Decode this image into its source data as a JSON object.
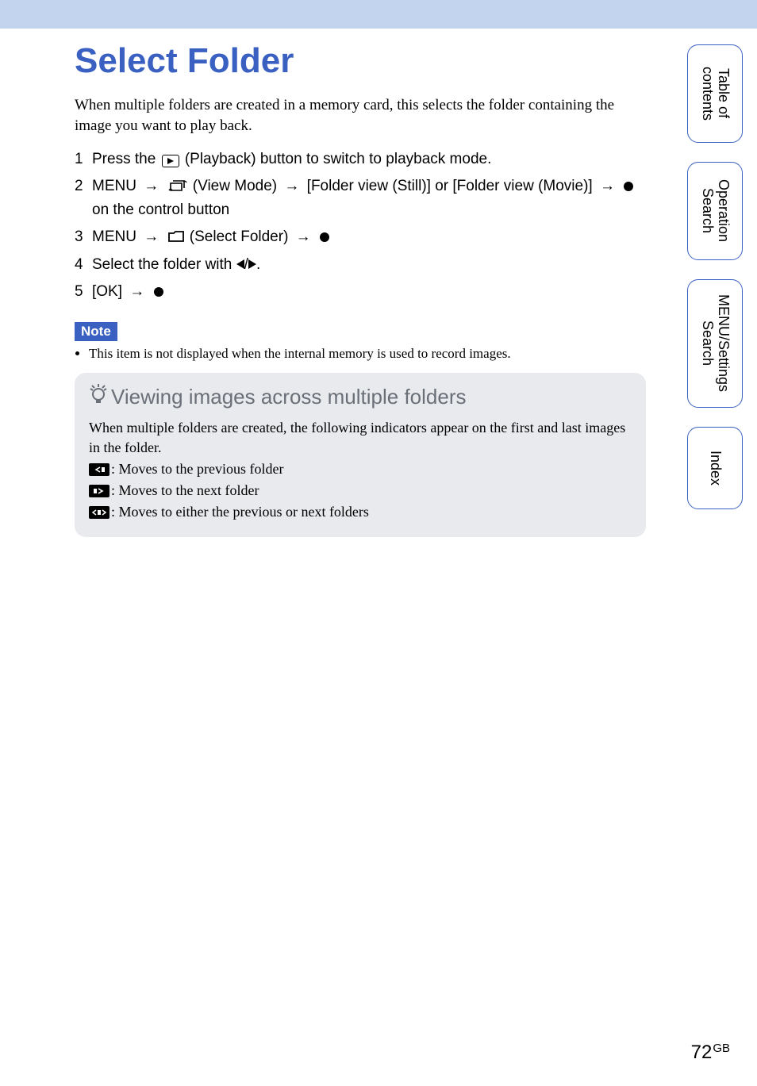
{
  "title": "Select Folder",
  "intro": "When multiple folders are created in a memory card, this selects the folder containing the image you want to play back.",
  "steps": {
    "s1_a": "Press the ",
    "s1_b": " (Playback) button to switch to playback mode.",
    "s2_a": "MENU ",
    "s2_b": " (View Mode) ",
    "s2_c": " [Folder view (Still)] or [Folder view (Movie)] ",
    "s2_d": " on the control button",
    "s3_a": "MENU ",
    "s3_b": " (Select Folder) ",
    "s4_a": "Select the folder with ",
    "s4_b": ".",
    "s5_a": "[OK] "
  },
  "note_label": "Note",
  "notes": [
    "This item is not displayed when the internal memory is used to record images."
  ],
  "tip": {
    "title": "Viewing images across multiple folders",
    "lead": "When multiple folders are created, the following indicators appear on the first and last images in the folder.",
    "ind1": ": Moves to the previous folder",
    "ind2": ": Moves to the next folder",
    "ind3": ": Moves to either the previous or next folders"
  },
  "tabs": {
    "toc": "Table of contents",
    "op": "Operation Search",
    "menu": "MENU/Settings Search",
    "index": "Index"
  },
  "page_number": "72",
  "page_suffix": "GB"
}
